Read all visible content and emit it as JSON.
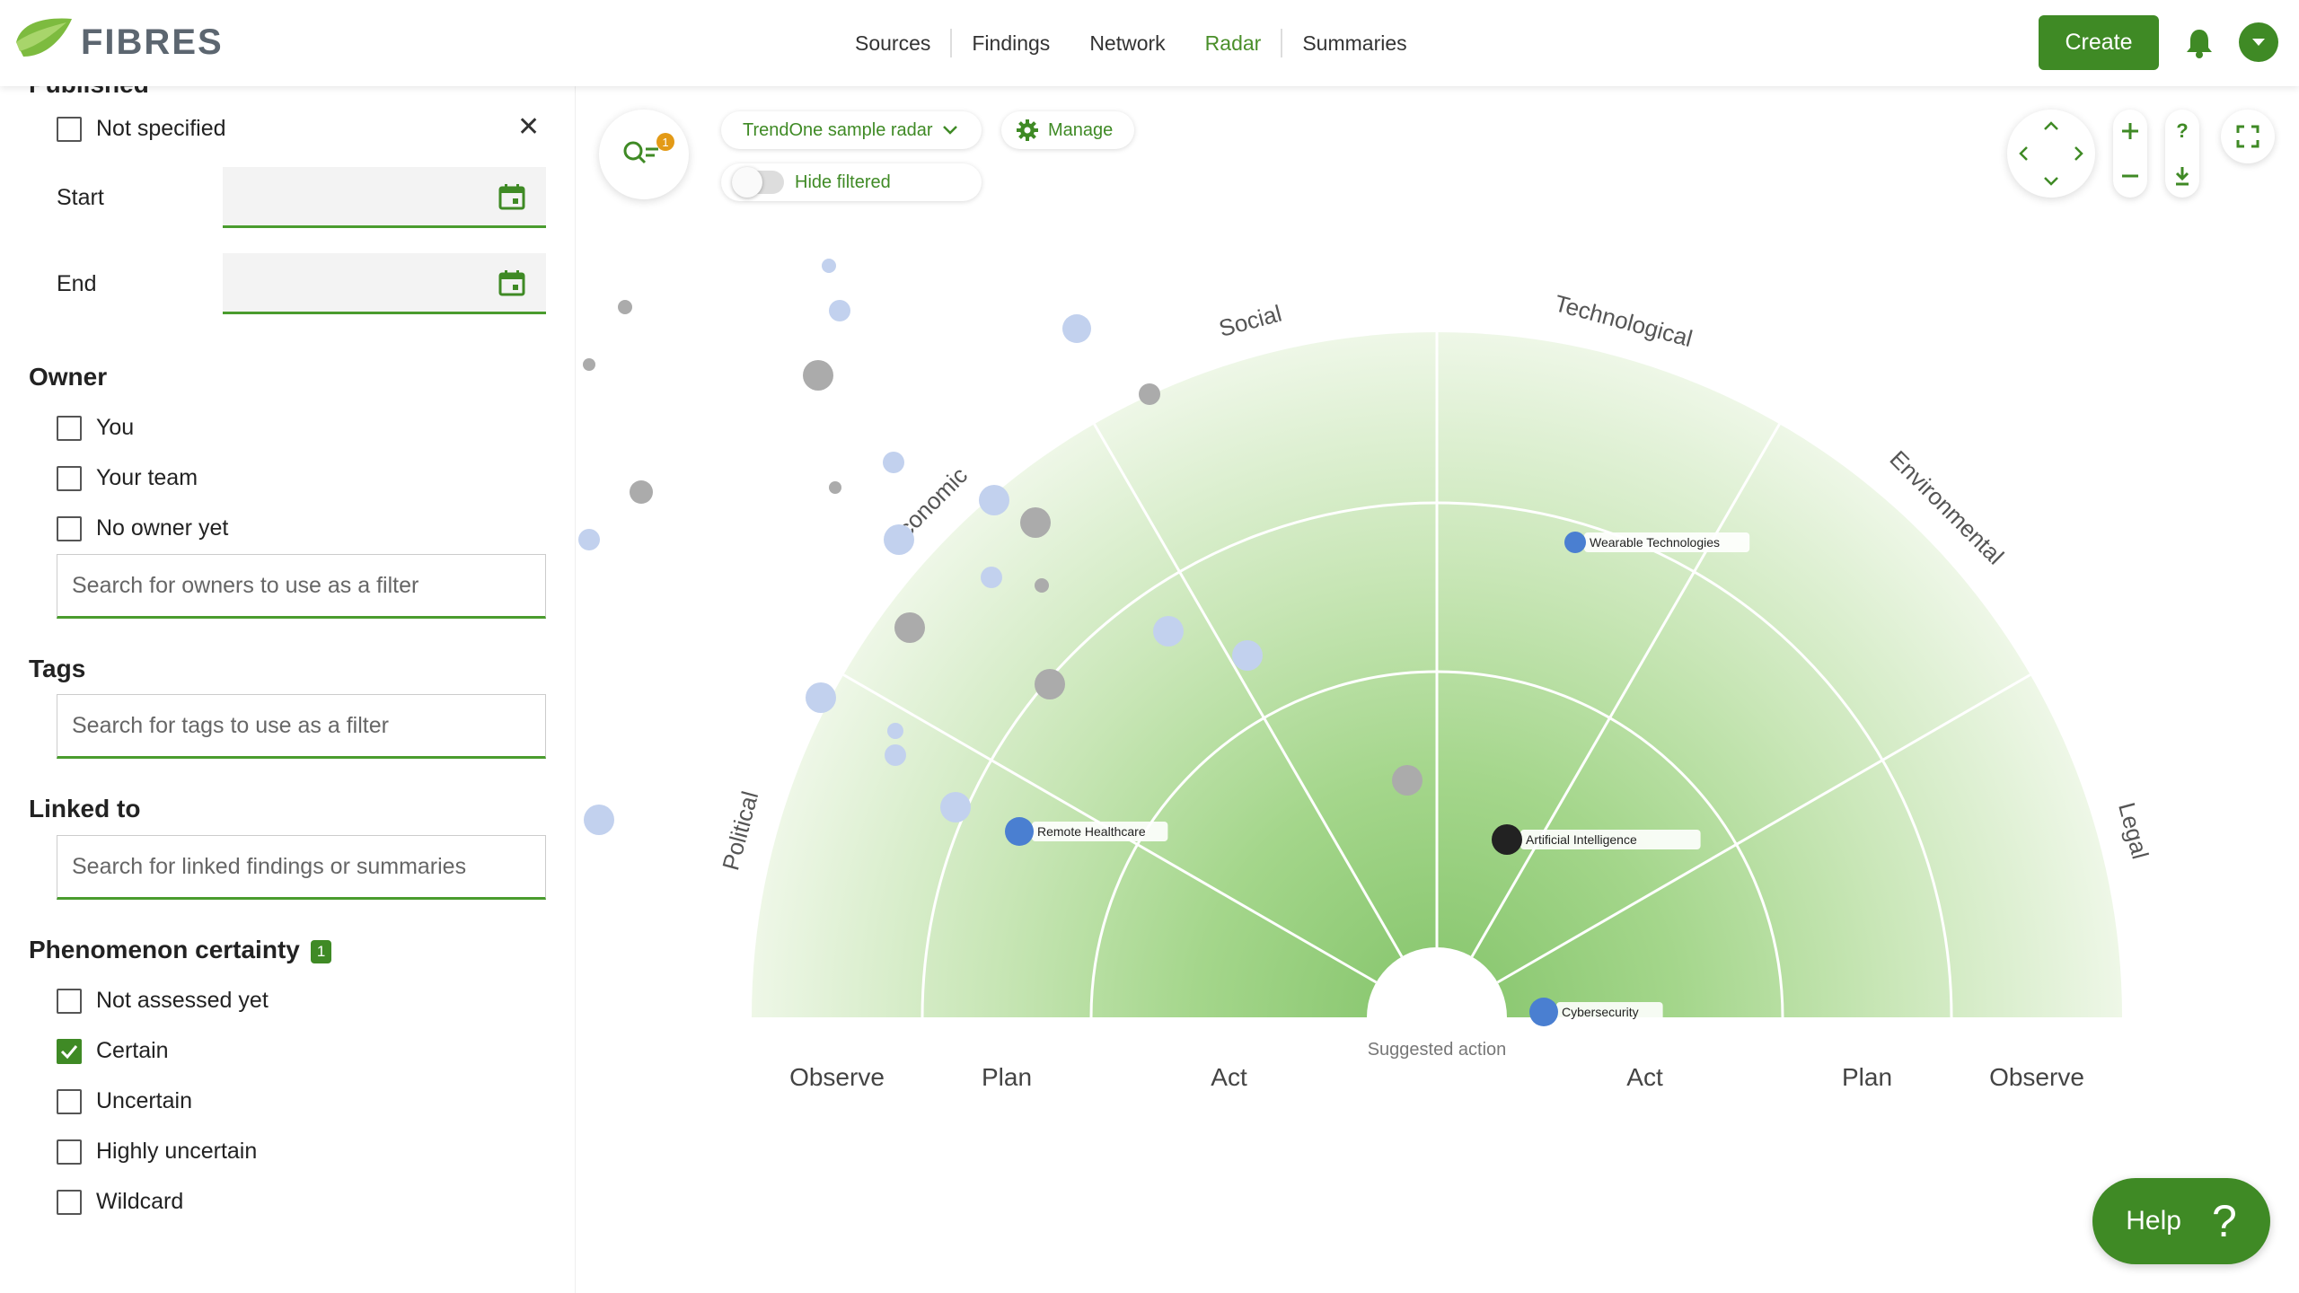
{
  "brand": {
    "name": "FIBRES"
  },
  "nav": {
    "items": [
      {
        "label": "Sources",
        "active": false
      },
      {
        "label": "Findings",
        "active": false
      },
      {
        "label": "Network",
        "active": false
      },
      {
        "label": "Radar",
        "active": true
      },
      {
        "label": "Summaries",
        "active": false
      }
    ],
    "create_label": "Create"
  },
  "sidebar": {
    "published": {
      "title_partial": "Published",
      "not_specified_label": "Not specified",
      "start_label": "Start",
      "end_label": "End"
    },
    "owner": {
      "title": "Owner",
      "options": [
        {
          "label": "You",
          "checked": false
        },
        {
          "label": "Your team",
          "checked": false
        },
        {
          "label": "No owner yet",
          "checked": false
        }
      ],
      "search_placeholder": "Search for owners to use as a filter"
    },
    "tags": {
      "title": "Tags",
      "search_placeholder": "Search for tags to use as a filter"
    },
    "linked": {
      "title": "Linked to",
      "search_placeholder": "Search for linked findings or summaries"
    },
    "certainty": {
      "title": "Phenomenon certainty",
      "count": "1",
      "options": [
        {
          "label": "Not assessed yet",
          "checked": false
        },
        {
          "label": "Certain",
          "checked": true
        },
        {
          "label": "Uncertain",
          "checked": false
        },
        {
          "label": "Highly uncertain",
          "checked": false
        },
        {
          "label": "Wildcard",
          "checked": false
        }
      ]
    }
  },
  "toolbar": {
    "filter_count": "1",
    "radar_name": "TrendOne sample radar",
    "manage_label": "Manage",
    "hide_filtered_label": "Hide filtered",
    "hide_filtered_on": false
  },
  "radar": {
    "sectors": [
      "Political",
      "Economic",
      "Social",
      "Technological",
      "Environmental",
      "Legal"
    ],
    "rings_left": [
      "Observe",
      "Plan",
      "Act"
    ],
    "rings_right": [
      "Act",
      "Plan",
      "Observe"
    ],
    "center_label": "Suggested action",
    "colors": {
      "labeled": "#4a7fd1",
      "light": "#c2d1ee",
      "gray": "#ababab",
      "highlight": "#222222"
    },
    "labeled_items": [
      {
        "label": "Remote Healthcare",
        "sector": "Economic",
        "ring": "Act",
        "color": "#4a7fd1"
      },
      {
        "label": "Wearable Technologies",
        "sector": "Technological",
        "ring": "Plan",
        "color": "#4a7fd1"
      },
      {
        "label": "Artificial Intelligence",
        "sector": "Technological",
        "ring": "Act",
        "color": "#222222"
      },
      {
        "label": "Cybersecurity",
        "sector": "Environmental",
        "ring": "Act",
        "color": "#4a7fd1"
      }
    ]
  },
  "help": {
    "label": "Help",
    "symbol": "?"
  }
}
